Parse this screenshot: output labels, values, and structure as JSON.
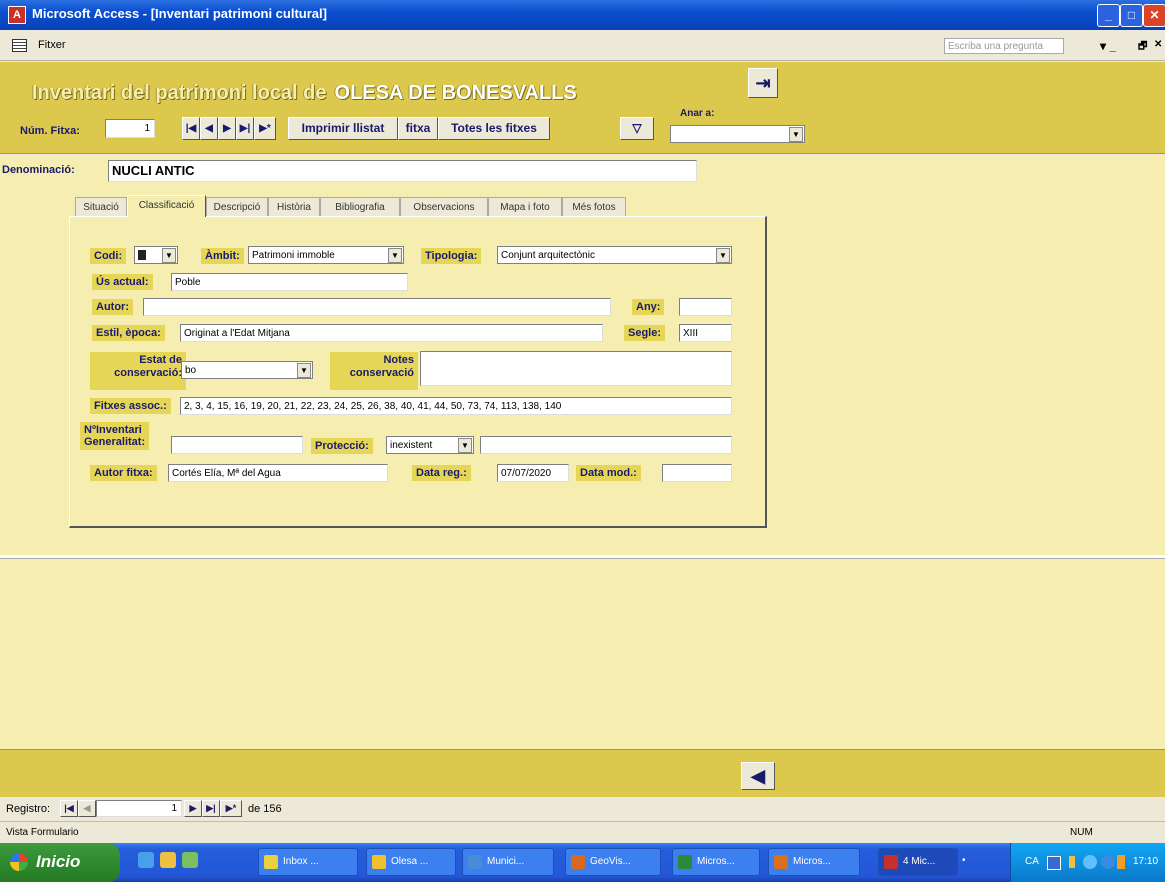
{
  "window": {
    "title": "Microsoft Access - [Inventari patrimoni cultural]",
    "min_glyph": "_",
    "max_glyph": "□",
    "close_glyph": "✕"
  },
  "menubar": {
    "file_label": "Fitxer",
    "question_placeholder": "Escriba una pregunta",
    "ctl_min": "▾ _",
    "ctl_restore": "🗗",
    "ctl_close": "✕"
  },
  "form": {
    "title": "Inventari del patrimoni local de",
    "town": "OLESA DE BONESVALLS",
    "num_fitxa_label": "Núm. Fitxa:",
    "num_fitxa_value": "1",
    "nav_first": "|◀",
    "nav_prev": "◀",
    "nav_next": "▶",
    "nav_last": "▶|",
    "nav_new": "▶*",
    "print_list_label": "Imprimir llistat",
    "print_card_label": "fitxa",
    "all_cards_label": "Totes les fitxes",
    "filter_icon": "filter-icon",
    "goto_label": "Anar a:",
    "goto_value": "",
    "exit_icon": "exit-door-icon",
    "denominacio_label": "Denominació:",
    "denominacio_value": "NUCLI ANTIC"
  },
  "tabs": [
    {
      "label": "Situació"
    },
    {
      "label": "Classificació"
    },
    {
      "label": "Descripció"
    },
    {
      "label": "Història"
    },
    {
      "label": "Bibliografia"
    },
    {
      "label": "Observacions"
    },
    {
      "label": "Mapa i foto"
    },
    {
      "label": "Més fotos"
    }
  ],
  "classificacio": {
    "codi_label": "Codi:",
    "codi_value": "",
    "ambit_label": "Àmbit:",
    "ambit_value": "Patrimoni immoble",
    "tipologia_label": "Tipologia:",
    "tipologia_value": "Conjunt arquitectònic",
    "us_label": "Ús actual:",
    "us_value": "Poble",
    "autor_label": "Autor:",
    "autor_value": "",
    "any_label": "Any:",
    "any_value": "",
    "estil_label": "Estil, època:",
    "estil_value": "Originat a l'Edat Mitjana",
    "segle_label": "Segle:",
    "segle_value": "XIII",
    "estat_label_1": "Estat de",
    "estat_label_2": "conservació:",
    "estat_value": "bo",
    "notes_label_1": "Notes",
    "notes_label_2": "conservació",
    "notes_value": "",
    "fitxes_label": "Fitxes assoc.:",
    "fitxes_value": "2, 3, 4, 15, 16, 19, 20, 21, 22, 23, 24, 25, 26, 38, 40, 41, 44, 50, 73, 74, 113, 138, 140",
    "ninv_label_1": "NºInventari",
    "ninv_label_2": "Generalitat:",
    "ninv_value": "",
    "proteccio_label": "Protecció:",
    "proteccio_value": "inexistent",
    "proteccio_extra": "",
    "autor_fitxa_label": "Autor fitxa:",
    "autor_fitxa_value": "Cortés Elía, Mª del Agua",
    "data_reg_label": "Data reg.:",
    "data_reg_value": "07/07/2020",
    "data_mod_label": "Data mod.:",
    "data_mod_value": ""
  },
  "footer": {
    "back_icon": "back-arrow-icon"
  },
  "record_nav": {
    "label": "Registro:",
    "current": "1",
    "of_text": "de 156"
  },
  "status": {
    "left": "Vista Formulario",
    "right": "NUM"
  },
  "taskbar": {
    "start_label": "Inicio",
    "items": [
      {
        "label": "Inbox ...",
        "color": "#e8d040"
      },
      {
        "label": "Olesa ...",
        "color": "#f0c030"
      },
      {
        "label": "Munici...",
        "color": "#4a8ad8"
      },
      {
        "label": "GeoVis...",
        "color": "#d86a20"
      },
      {
        "label": "Micros...",
        "color": "#2a8a3a"
      },
      {
        "label": "Micros...",
        "color": "#d87020"
      },
      {
        "label": "4 Mic...",
        "color": "#c8302a"
      }
    ],
    "tray_lang": "CA",
    "tray_time": "17:10"
  }
}
